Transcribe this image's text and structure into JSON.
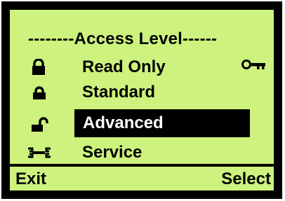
{
  "screen": {
    "title": "--------Access Level------",
    "background_color": "#cdf27d",
    "highlight_color": "#000000"
  },
  "menu": {
    "items": [
      {
        "label": "Read Only",
        "icon": "lock-closed-icon",
        "selected": false,
        "current_indicator": "key-icon"
      },
      {
        "label": "Standard",
        "icon": "lock-half-icon",
        "selected": false
      },
      {
        "label": "Advanced",
        "icon": "lock-open-icon",
        "selected": true
      },
      {
        "label": "Service",
        "icon": "wrench-icon",
        "selected": false
      }
    ]
  },
  "softkeys": {
    "left_label": "Exit",
    "right_label": "Select"
  }
}
